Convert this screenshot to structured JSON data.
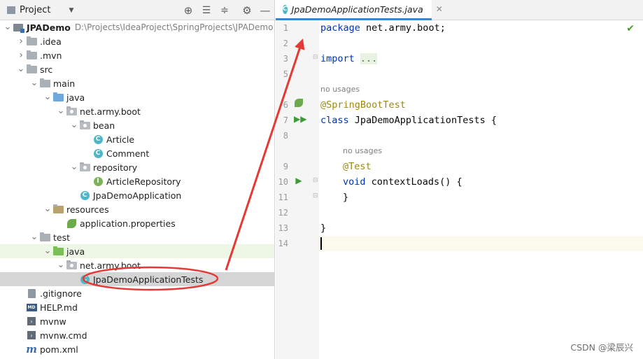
{
  "project_panel": {
    "title": "Project",
    "toolbar_icons": [
      "target-icon",
      "expand-all-icon",
      "collapse-all-icon",
      "gear-icon",
      "minimize-icon"
    ],
    "tree": [
      {
        "label": "JPADemo",
        "hint": "D:\\Projects\\IdeaProject\\SpringProjects\\JPADemo",
        "indent": 0,
        "arrow": "down",
        "icon": "module-icon"
      },
      {
        "label": ".idea",
        "indent": 1,
        "arrow": "right",
        "icon": "folder-icon"
      },
      {
        "label": ".mvn",
        "indent": 1,
        "arrow": "right",
        "icon": "folder-icon"
      },
      {
        "label": "src",
        "indent": 1,
        "arrow": "down",
        "icon": "folder-icon"
      },
      {
        "label": "main",
        "indent": 2,
        "arrow": "down",
        "icon": "folder-icon"
      },
      {
        "label": "java",
        "indent": 3,
        "arrow": "down",
        "icon": "source-folder-icon"
      },
      {
        "label": "net.army.boot",
        "indent": 4,
        "arrow": "down",
        "icon": "package-icon"
      },
      {
        "label": "bean",
        "indent": 5,
        "arrow": "down",
        "icon": "package-icon"
      },
      {
        "label": "Article",
        "indent": 6,
        "arrow": "none",
        "icon": "class-icon"
      },
      {
        "label": "Comment",
        "indent": 6,
        "arrow": "none",
        "icon": "class-icon"
      },
      {
        "label": "repository",
        "indent": 5,
        "arrow": "down",
        "icon": "package-icon"
      },
      {
        "label": "ArticleRepository",
        "indent": 6,
        "arrow": "none",
        "icon": "interface-icon"
      },
      {
        "label": "JpaDemoApplication",
        "indent": 5,
        "arrow": "none",
        "icon": "spring-class-icon"
      },
      {
        "label": "resources",
        "indent": 3,
        "arrow": "down",
        "icon": "resources-folder-icon"
      },
      {
        "label": "application.properties",
        "indent": 4,
        "arrow": "none",
        "icon": "spring-leaf-icon"
      },
      {
        "label": "test",
        "indent": 2,
        "arrow": "down",
        "icon": "folder-icon"
      },
      {
        "label": "java",
        "indent": 3,
        "arrow": "down",
        "icon": "test-folder-icon",
        "highlight": "green"
      },
      {
        "label": "net.army.boot",
        "indent": 4,
        "arrow": "down",
        "icon": "package-icon"
      },
      {
        "label": "JpaDemoApplicationTests",
        "indent": 5,
        "arrow": "none",
        "icon": "class-icon",
        "highlight": "selected"
      },
      {
        "label": ".gitignore",
        "indent": 1,
        "arrow": "none",
        "icon": "file-icon"
      },
      {
        "label": "HELP.md",
        "indent": 1,
        "arrow": "none",
        "icon": "markdown-icon"
      },
      {
        "label": "mvnw",
        "indent": 1,
        "arrow": "none",
        "icon": "terminal-icon"
      },
      {
        "label": "mvnw.cmd",
        "indent": 1,
        "arrow": "none",
        "icon": "terminal-icon"
      },
      {
        "label": "pom.xml",
        "indent": 1,
        "arrow": "none",
        "icon": "maven-icon"
      }
    ]
  },
  "editor": {
    "tab_label": "JpaDemoApplicationTests.java",
    "line_numbers": [
      "1",
      "2",
      "3",
      "5",
      "6",
      "7",
      "8",
      "9",
      "10",
      "11",
      "12",
      "13",
      "14"
    ],
    "inlay_hints": [
      "no usages",
      "no usages"
    ],
    "code": {
      "package_kw": "package",
      "package_name": " net.army.boot;",
      "import_kw": "import",
      "import_dots": "...",
      "annotation_class": "@SpringBootTest",
      "class_kw": "class",
      "class_name": " JpaDemoApplicationTests {",
      "annotation_method": "@Test",
      "void_kw": "void",
      "method_sig": " contextLoads() {",
      "method_close": "}",
      "class_close": "}"
    },
    "status_icon": "check-icon"
  },
  "watermark": "CSDN @梁辰兴",
  "colors": {
    "keyword": "#0033b3",
    "annotation": "#9e880d",
    "annotation_circle": "#e53935",
    "selection": "#d5d5d5",
    "tab_underline": "#4083c9"
  }
}
